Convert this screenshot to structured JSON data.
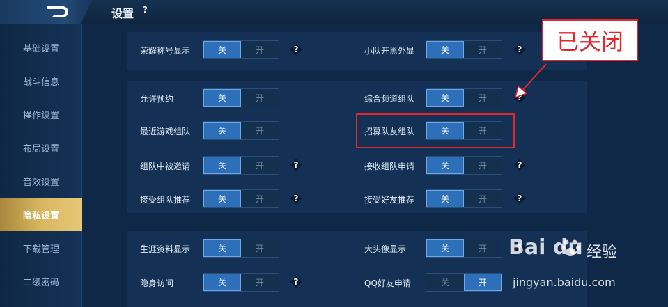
{
  "header": {
    "title": "设置",
    "help": "?"
  },
  "sidebar": {
    "items": [
      {
        "label": "基础设置"
      },
      {
        "label": "战斗信息"
      },
      {
        "label": "操作设置"
      },
      {
        "label": "布局设置"
      },
      {
        "label": "音效设置"
      },
      {
        "label": "隐私设置",
        "active": true
      },
      {
        "label": "下载管理"
      },
      {
        "label": "二级密码"
      }
    ]
  },
  "toggle_labels": {
    "off": "关",
    "on": "开"
  },
  "help_glyph": "?",
  "settings": {
    "left": [
      {
        "label": "荣耀称号显示",
        "state": "off",
        "help": true
      },
      {
        "label": "允许预约",
        "state": "off",
        "help": false
      },
      {
        "label": "最近游戏组队",
        "state": "off",
        "help": false
      },
      {
        "label": "组队中被邀请",
        "state": "off",
        "help": true
      },
      {
        "label": "接受组队推荐",
        "state": "off",
        "help": true
      },
      {
        "label": "生涯资料显示",
        "state": "off",
        "help": false
      },
      {
        "label": "隐身访问",
        "state": "off",
        "help": true
      }
    ],
    "right": [
      {
        "label": "小队开黑外显",
        "state": "off",
        "help": true
      },
      {
        "label": "综合频道组队",
        "state": "off",
        "help": true
      },
      {
        "label": "招募队友组队",
        "state": "off",
        "help": false
      },
      {
        "label": "接收组队申请",
        "state": "off",
        "help": true
      },
      {
        "label": "接受好友推荐",
        "state": "off",
        "help": true
      },
      {
        "label": "大头像显示",
        "state": "off",
        "help": true
      },
      {
        "label": "QQ好友申请",
        "state": "on",
        "help": false
      }
    ]
  },
  "annotation": {
    "callout": "已关闭",
    "color": "#e5262c"
  },
  "watermark": {
    "logo": "Bai du",
    "brand": "经验",
    "url": "jingyan.baidu.com"
  },
  "colors": {
    "background": "#0f2848",
    "toggle_active": "#2d6fb8",
    "sidebar_active": "#d9b760"
  }
}
